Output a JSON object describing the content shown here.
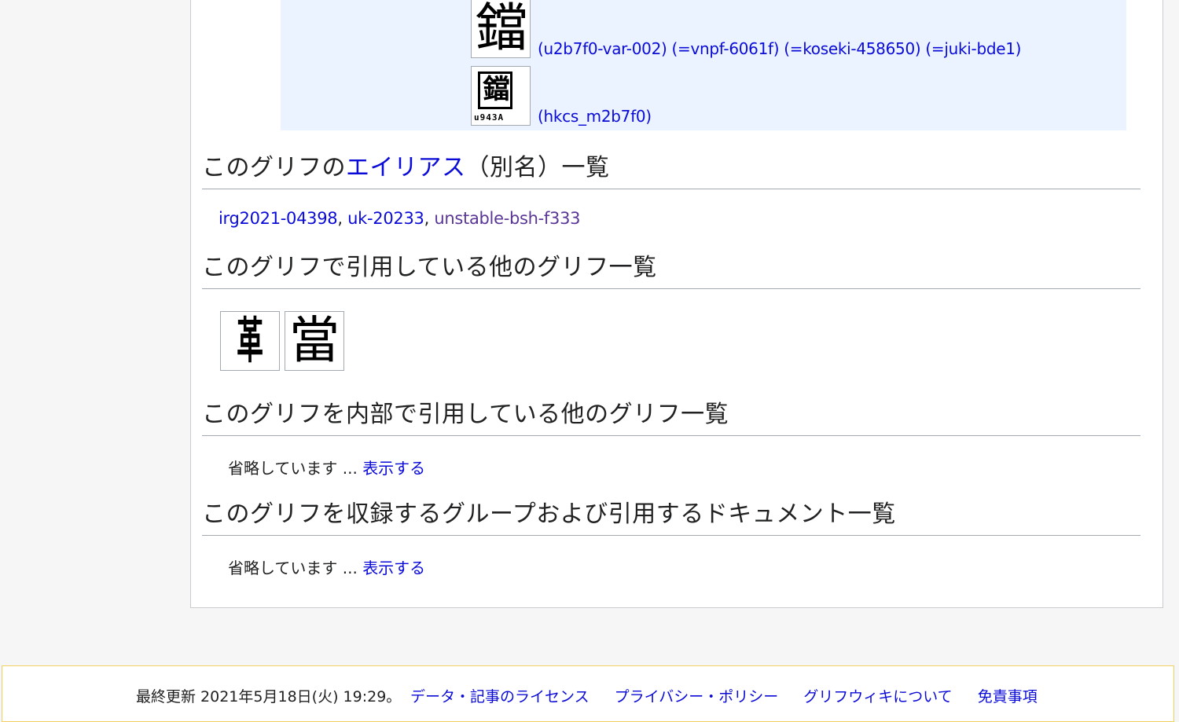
{
  "variants": {
    "rows": [
      {
        "glyph": "鐺",
        "links": [
          "(u2b7f0-var-002)",
          "(=vnpf-6061f)",
          "(=koseki-458650)",
          "(=juki-bde1)"
        ]
      },
      {
        "glyph": "鐺",
        "side_label": "u943A",
        "links": [
          "(hkcs_m2b7f0)"
        ]
      }
    ]
  },
  "sections": {
    "alias": {
      "title_pre": "このグリフの",
      "title_link": "エイリアス",
      "title_post": "（別名）一覧",
      "items": [
        "irg2021-04398",
        "uk-20233",
        "unstable-bsh-f333"
      ],
      "separator": ", "
    },
    "references": {
      "title": "このグリフで引用している他のグリフ一覧",
      "glyphs": [
        "革",
        "當"
      ]
    },
    "referenced_by": {
      "title": "このグリフを内部で引用している他のグリフ一覧",
      "omitted_text": "省略しています ... ",
      "show_link": "表示する"
    },
    "groups": {
      "title": "このグリフを収録するグループおよび引用するドキュメント一覧",
      "omitted_text": "省略しています ... ",
      "show_link": "表示する"
    }
  },
  "footer": {
    "last_modified": "最終更新 2021年5月18日(火) 19:29。",
    "links": [
      "データ・記事のライセンス",
      "プライバシー・ポリシー",
      "グリフウィキについて",
      "免責事項"
    ]
  }
}
